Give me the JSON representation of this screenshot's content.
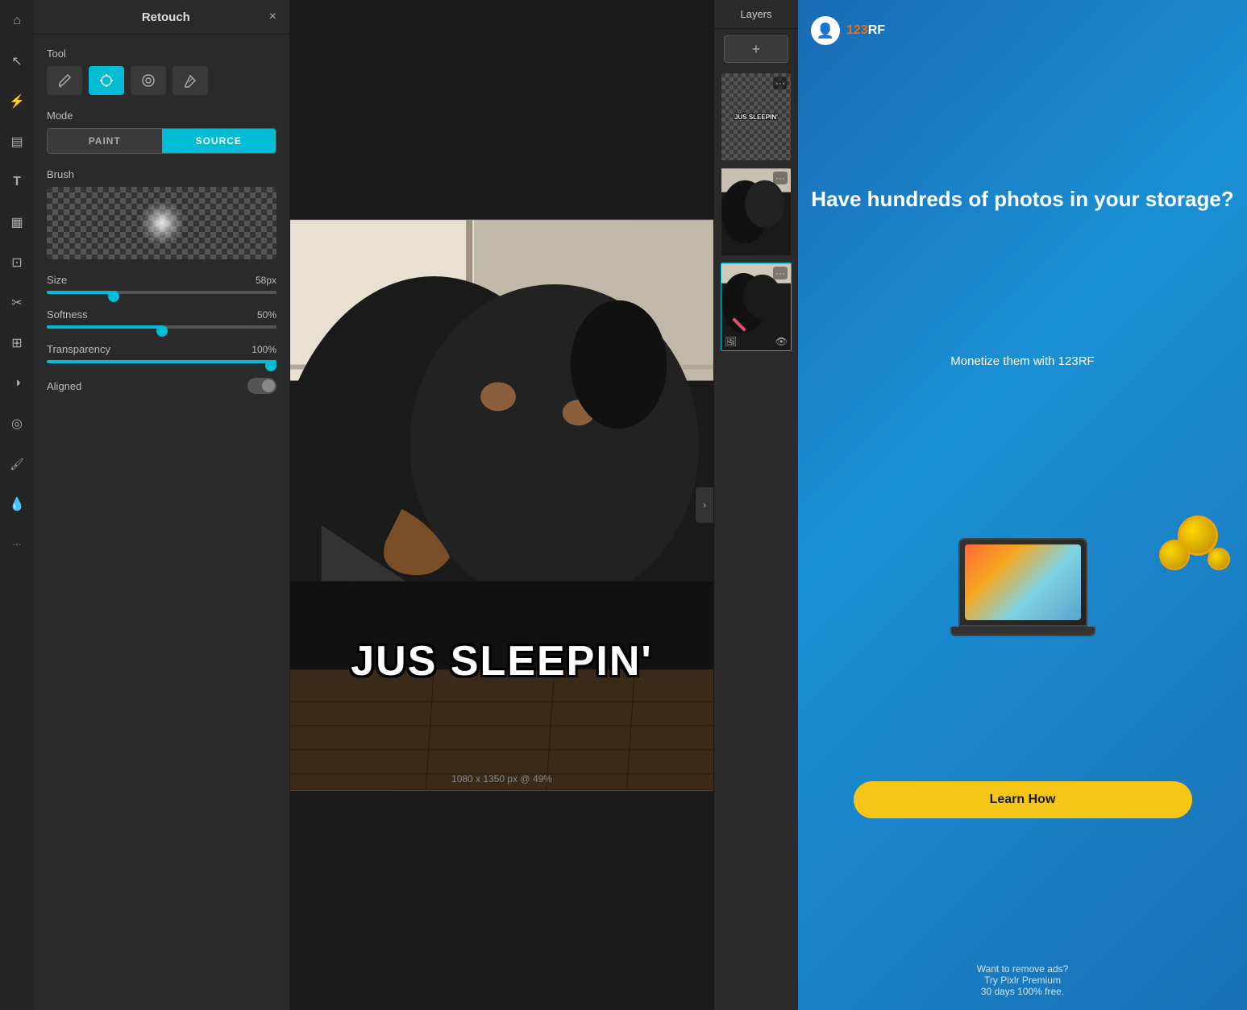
{
  "app": {
    "title": "Retouch",
    "close_label": "×"
  },
  "tool": {
    "label": "Tool",
    "buttons": [
      {
        "id": "paint-brush",
        "icon": "✏",
        "active": false
      },
      {
        "id": "clone-stamp",
        "icon": "⊕",
        "active": true
      },
      {
        "id": "healing",
        "icon": "◉",
        "active": false
      },
      {
        "id": "eraser",
        "icon": "⊘",
        "active": false
      }
    ]
  },
  "mode": {
    "label": "Mode",
    "options": [
      {
        "id": "paint",
        "label": "PAINT",
        "active": false
      },
      {
        "id": "source",
        "label": "SOURCE",
        "active": true
      }
    ]
  },
  "brush": {
    "label": "Brush"
  },
  "size": {
    "label": "Size",
    "value": "58px",
    "percent": 28
  },
  "softness": {
    "label": "Softness",
    "value": "50%",
    "percent": 50
  },
  "transparency": {
    "label": "Transparency",
    "value": "100%",
    "percent": 100
  },
  "aligned": {
    "label": "Aligned",
    "enabled": false
  },
  "layers": {
    "header": "Layers",
    "add_btn": "+"
  },
  "canvas": {
    "text": "JUS SLEEPIN'",
    "status": "1080 x 1350 px @ 49%"
  },
  "ad": {
    "logo": "123RF",
    "logo_icon": "👤",
    "headline": "Have hundreds of photos in your storage?",
    "subheadline": "Monetize them with 123RF",
    "cta_button": "Learn How",
    "remove_ads_line1": "Want to remove ads?",
    "remove_ads_line2": "Try Pixlr Premium",
    "remove_ads_line3": "30 days 100% free."
  },
  "left_icons": [
    {
      "name": "home",
      "icon": "⌂"
    },
    {
      "name": "cursor",
      "icon": "↖"
    },
    {
      "name": "lightning",
      "icon": "⚡"
    },
    {
      "name": "layers-icon",
      "icon": "▤"
    },
    {
      "name": "text-tool",
      "icon": "T"
    },
    {
      "name": "grid",
      "icon": "▦"
    },
    {
      "name": "crop",
      "icon": "⊡"
    },
    {
      "name": "scissors",
      "icon": "✂"
    },
    {
      "name": "sliders",
      "icon": "⊞"
    },
    {
      "name": "circle-half",
      "icon": "◑"
    },
    {
      "name": "spiral",
      "icon": "◎"
    },
    {
      "name": "brush-side",
      "icon": "🖌"
    },
    {
      "name": "dropper",
      "icon": "💧"
    },
    {
      "name": "more",
      "icon": "···"
    }
  ]
}
